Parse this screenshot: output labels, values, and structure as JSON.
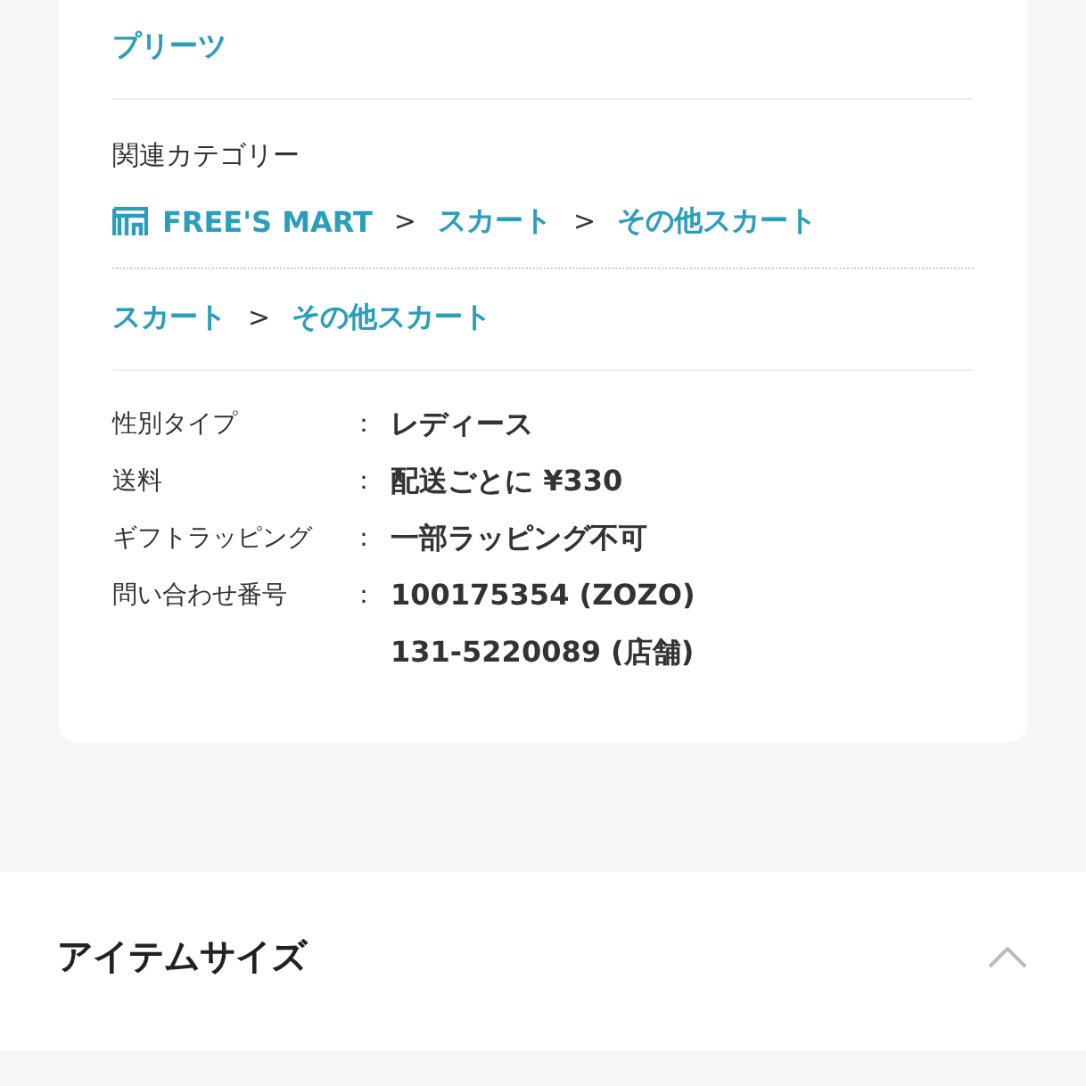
{
  "feature_value": "プリーツ",
  "related_category": {
    "title": "関連カテゴリー",
    "paths": [
      {
        "items": [
          {
            "kind": "shop",
            "label": "FREE'S MART"
          },
          {
            "kind": "separator",
            "label": ">"
          },
          {
            "kind": "link",
            "label": "スカート"
          },
          {
            "kind": "separator",
            "label": ">"
          },
          {
            "kind": "link",
            "label": "その他スカート"
          }
        ]
      },
      {
        "items": [
          {
            "kind": "link",
            "label": "スカート"
          },
          {
            "kind": "separator",
            "label": ">"
          },
          {
            "kind": "link",
            "label": "その他スカート"
          }
        ]
      }
    ]
  },
  "specs": [
    {
      "label": "性別タイプ",
      "colon": "：",
      "values": [
        "レディース"
      ]
    },
    {
      "label": "送料",
      "colon": "：",
      "values": [
        "配送ごとに ¥330"
      ]
    },
    {
      "label": "ギフトラッピング",
      "colon": "：",
      "values": [
        "一部ラッピング不可"
      ]
    },
    {
      "label": "問い合わせ番号",
      "colon": "：",
      "values": [
        "100175354 (ZOZO)",
        "131-5220089 (店舗)"
      ]
    }
  ],
  "accordion": {
    "title": "アイテムサイズ",
    "expanded": true
  }
}
